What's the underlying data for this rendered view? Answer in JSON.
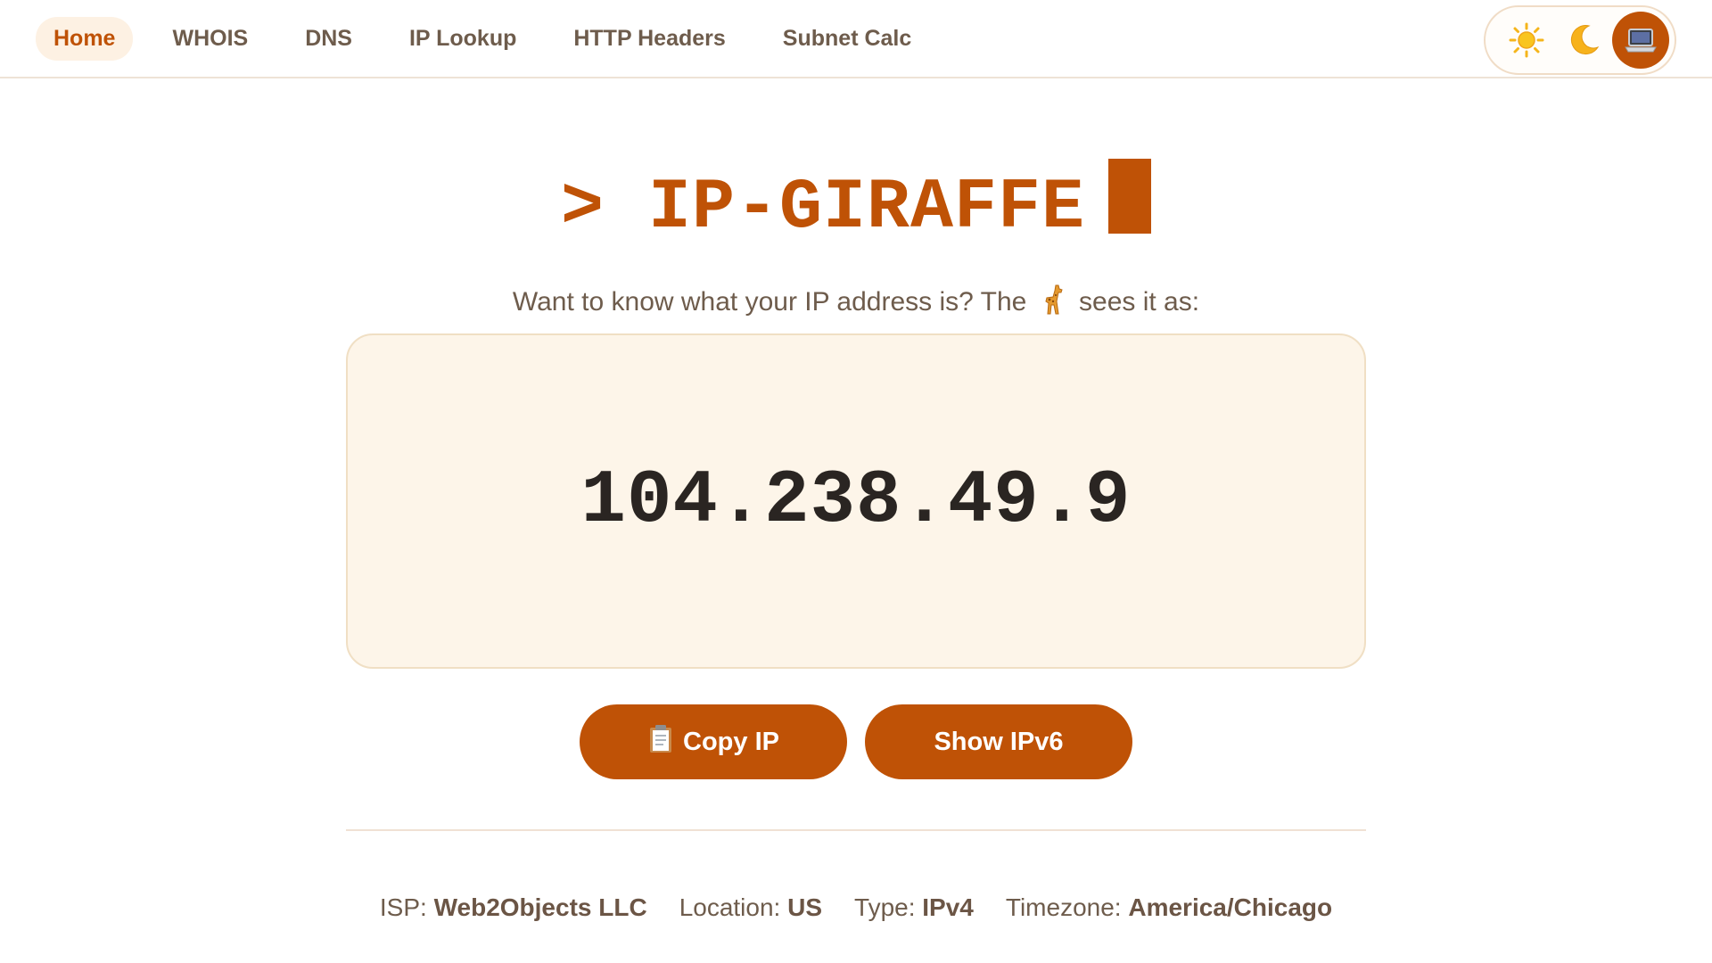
{
  "nav": {
    "items": [
      {
        "label": "Home",
        "active": true
      },
      {
        "label": "WHOIS",
        "active": false
      },
      {
        "label": "DNS",
        "active": false
      },
      {
        "label": "IP Lookup",
        "active": false
      },
      {
        "label": "HTTP Headers",
        "active": false
      },
      {
        "label": "Subnet Calc",
        "active": false
      }
    ]
  },
  "theme": {
    "options": [
      {
        "icon": "sun-icon",
        "selected": false
      },
      {
        "icon": "moon-icon",
        "selected": false
      },
      {
        "icon": "laptop-icon",
        "selected": true
      }
    ]
  },
  "hero": {
    "title": "> IP-GIRAFFE",
    "subtitle_before": "Want to know what your IP address is? The",
    "subtitle_icon": "giraffe-icon",
    "subtitle_after": "sees it as:",
    "ip_address": "104.238.49.9"
  },
  "actions": {
    "copy_label": "Copy IP",
    "copy_icon": "clipboard-icon",
    "ipv6_label": "Show IPv6"
  },
  "info": {
    "isp_label": "ISP:",
    "isp_value": "Web2Objects LLC",
    "location_label": "Location:",
    "location_value": "US",
    "type_label": "Type:",
    "type_value": "IPv4",
    "timezone_label": "Timezone:",
    "timezone_value": "America/Chicago"
  },
  "colors": {
    "accent": "#bf5206",
    "card_bg": "#fdf5e9",
    "text": "#6e5c4c",
    "ip_text": "#2a2522"
  }
}
